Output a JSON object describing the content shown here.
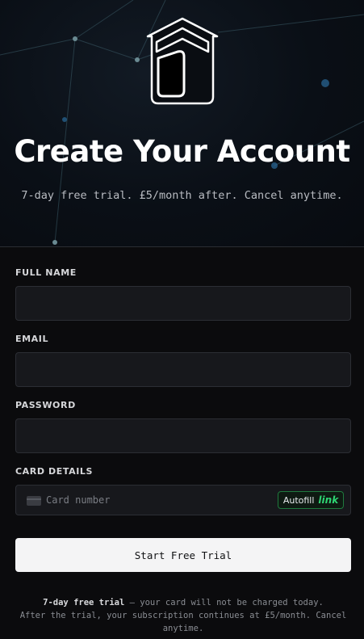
{
  "hero": {
    "title": "Create Your Account",
    "subtitle": "7-day free trial. £5/month after. Cancel anytime."
  },
  "form": {
    "full_name_label": "FULL NAME",
    "email_label": "EMAIL",
    "password_label": "PASSWORD",
    "card_label": "CARD DETAILS",
    "card_placeholder": "Card number",
    "autofill_label": "Autofill",
    "autofill_brand": "link"
  },
  "submit_label": "Start Free Trial",
  "notice": {
    "bold": "7-day free trial",
    "line1_rest": " — your card will not be charged today.",
    "line2": "After the trial, your subscription continues at £5/month. Cancel anytime."
  },
  "colors": {
    "background": "#0b0b0d",
    "input_bg": "#17181c",
    "link_green": "#2ed573",
    "button_bg": "#f4f4f5"
  }
}
